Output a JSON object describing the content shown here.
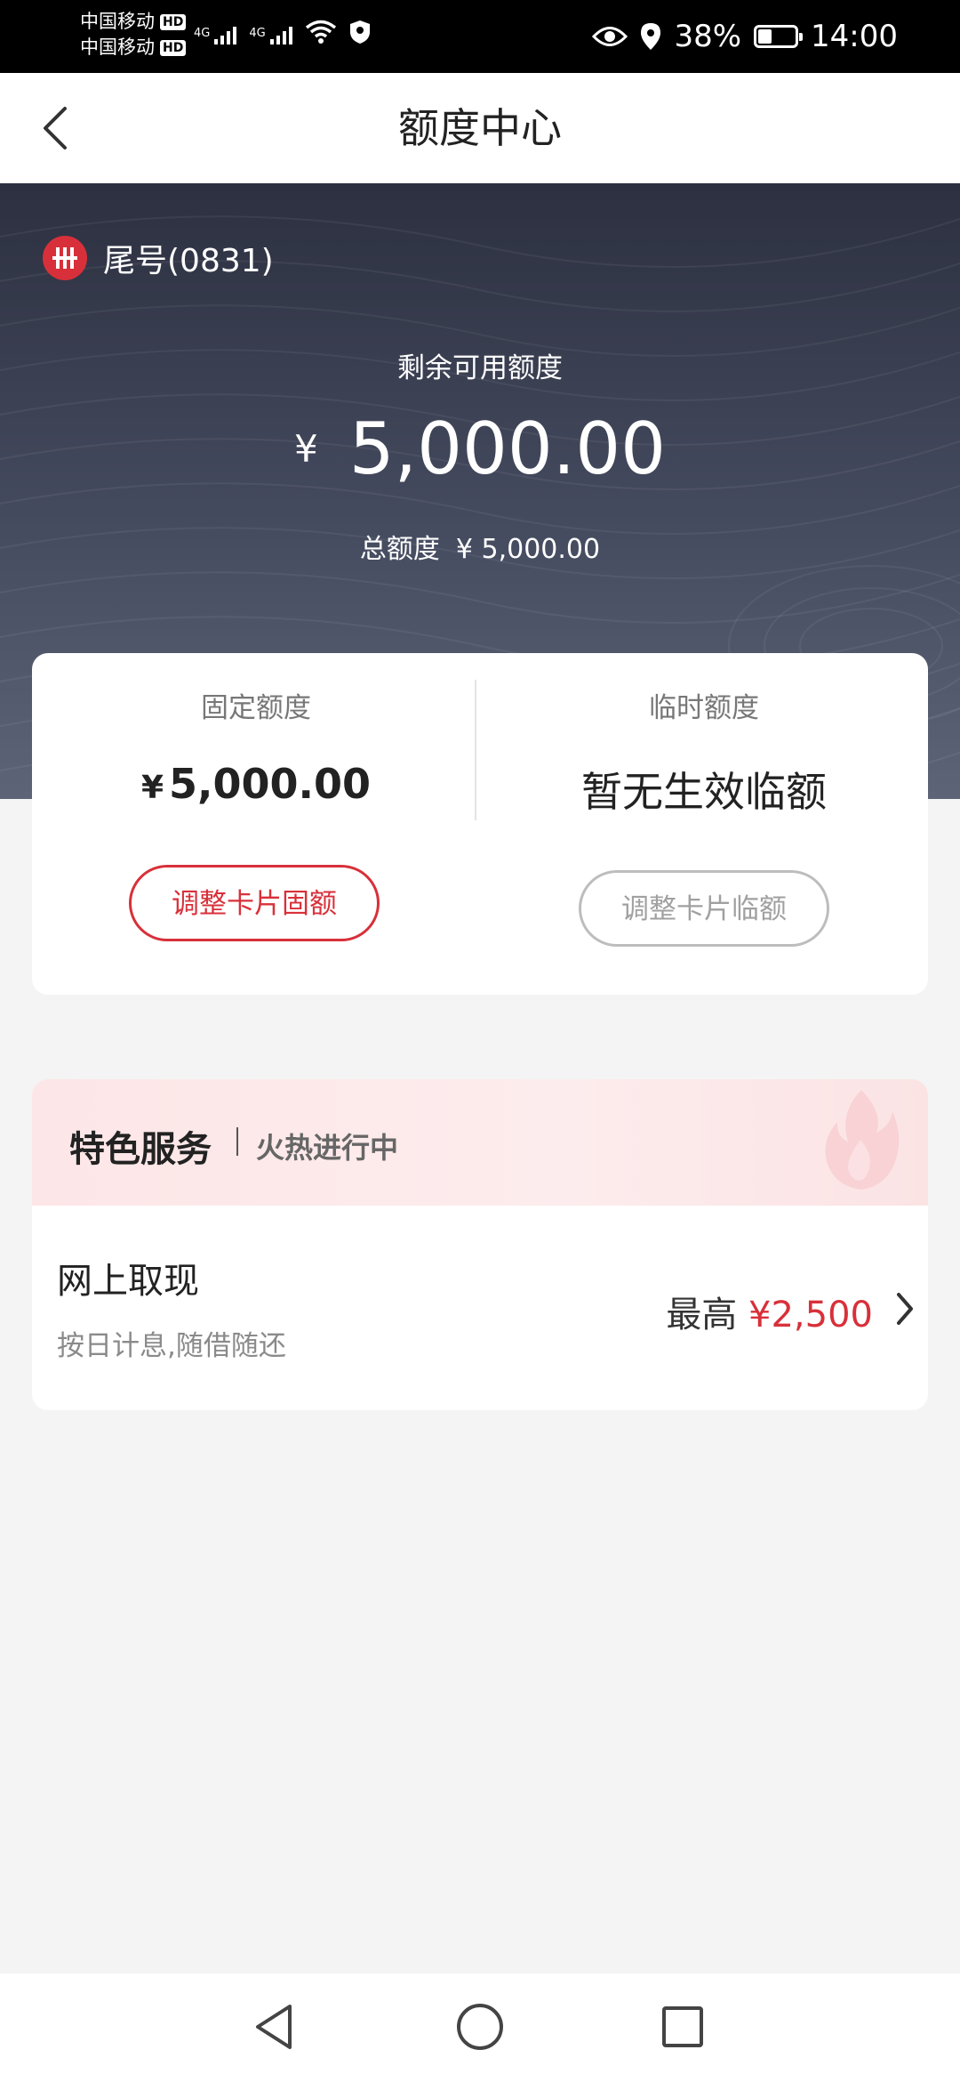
{
  "status_bar": {
    "carrier_1": "中国移动",
    "carrier_2": "中国移动",
    "hd_badge": "HD",
    "network": "4G",
    "battery": "38%",
    "battery_level": 0.38,
    "time": "14:00"
  },
  "header": {
    "title": "额度中心"
  },
  "card": {
    "tail_label": "尾号(0831)",
    "remaining_label": "剩余可用额度",
    "currency": "¥",
    "remaining_amount": "5,000.00",
    "total_label": "总额度",
    "total_amount": "¥ 5,000.00"
  },
  "limits": {
    "fixed_label": "固定额度",
    "fixed_currency": "¥",
    "fixed_value": "5,000.00",
    "fixed_button": "调整卡片固额",
    "temp_label": "临时额度",
    "temp_value": "暂无生效临额",
    "temp_button": "调整卡片临额"
  },
  "services": {
    "title": "特色服务",
    "subtitle": "火热进行中",
    "items": [
      {
        "title": "网上取现",
        "desc": "按日计息,随借随还",
        "max_label": "最高",
        "max_amount": "¥2,500"
      }
    ]
  },
  "colors": {
    "accent_red": "#d8303a",
    "hero_dark": "#2c3040",
    "page_bg": "#f4f4f4"
  },
  "icons": [
    "back-arrow-icon",
    "bank-logo-icon",
    "flame-icon",
    "chevron-right-icon",
    "nav-back-icon",
    "nav-home-icon",
    "nav-recents-icon",
    "eye-icon",
    "location-icon",
    "wifi-icon",
    "battery-icon"
  ]
}
